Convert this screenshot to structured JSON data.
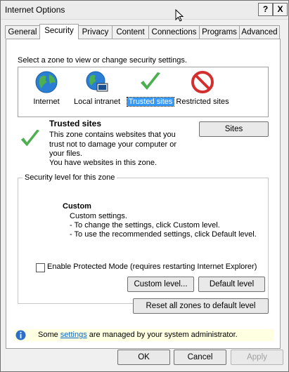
{
  "window": {
    "title": "Internet Options",
    "help_label": "?",
    "close_label": "X"
  },
  "tabs": [
    {
      "label": "General"
    },
    {
      "label": "Security"
    },
    {
      "label": "Privacy"
    },
    {
      "label": "Content"
    },
    {
      "label": "Connections"
    },
    {
      "label": "Programs"
    },
    {
      "label": "Advanced"
    }
  ],
  "security": {
    "instruction": "Select a zone to view or change security settings.",
    "zones": [
      {
        "label": "Internet",
        "icon": "globe-icon"
      },
      {
        "label": "Local intranet",
        "icon": "intranet-globe-icon"
      },
      {
        "label": "Trusted sites",
        "icon": "checkmark-icon",
        "selected": true
      },
      {
        "label": "Restricted sites",
        "icon": "no-entry-icon"
      }
    ],
    "selected_zone": {
      "name": "Trusted sites",
      "description": "This zone contains websites that you trust not to damage your computer or your files.",
      "note": "You have websites in this zone."
    },
    "sites_button": "Sites",
    "level_group_title": "Security level for this zone",
    "level_name": "Custom",
    "level_lines": [
      "Custom settings.",
      "- To change the settings, click Custom level.",
      "- To use the recommended settings, click Default level."
    ],
    "protected_mode_label": "Enable Protected Mode (requires restarting Internet Explorer)",
    "protected_mode_checked": false,
    "custom_level_button": "Custom level...",
    "default_level_button": "Default level",
    "reset_all_button": "Reset all zones to default level",
    "info_prefix": "Some ",
    "info_link": "settings",
    "info_suffix": " are managed by your system administrator."
  },
  "footer": {
    "ok": "OK",
    "cancel": "Cancel",
    "apply": "Apply"
  },
  "colors": {
    "accent": "#3399ff",
    "check_green": "#4caf50",
    "restricted_red": "#d32f2f",
    "info_bar": "#ffffe1"
  }
}
